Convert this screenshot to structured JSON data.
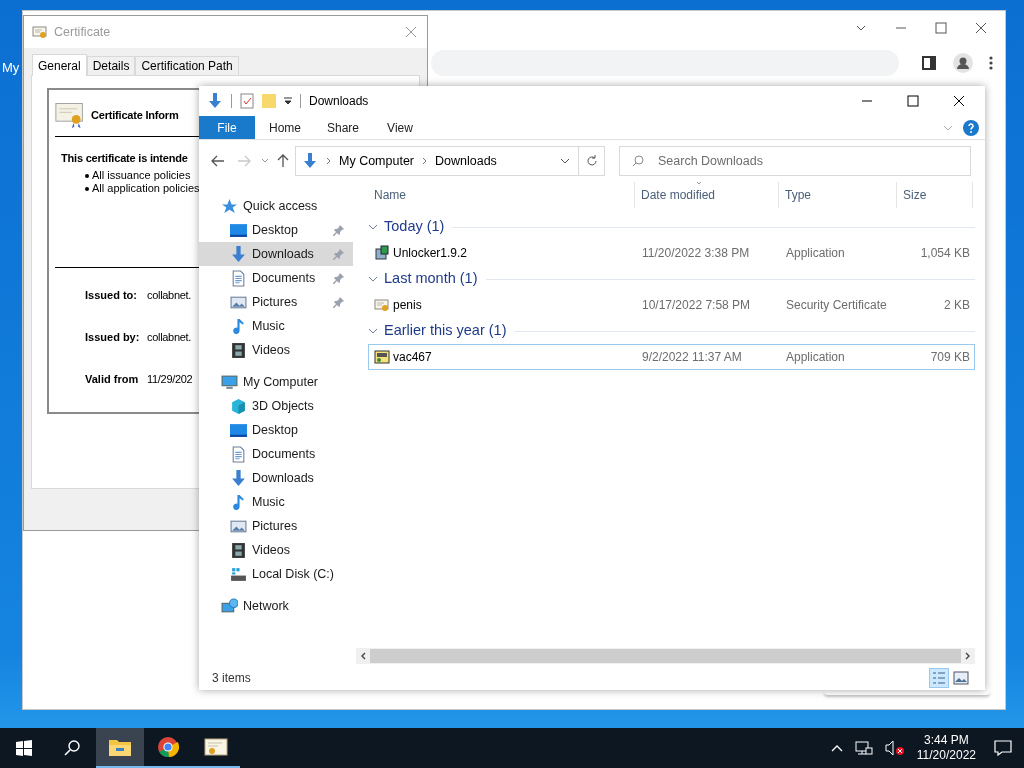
{
  "desktop": {
    "icon_label": "My"
  },
  "certificate": {
    "title": "Certificate",
    "tabs": [
      {
        "label": "General",
        "selected": true
      },
      {
        "label": "Details",
        "selected": false
      },
      {
        "label": "Certification Path",
        "selected": false
      }
    ],
    "heading": "Certificate Inform",
    "purpose": "This certificate is intende",
    "policies": [
      "All issuance policies",
      "All application policies"
    ],
    "fields": [
      {
        "label": "Issued to:",
        "value": "collabnet."
      },
      {
        "label": "Issued by:",
        "value": "collabnet."
      },
      {
        "label": "Valid from",
        "value": "11/29/202"
      }
    ]
  },
  "explorer": {
    "title": "Downloads",
    "ribbon_tabs": [
      {
        "label": "File",
        "selected": true
      },
      {
        "label": "Home",
        "selected": false
      },
      {
        "label": "Share",
        "selected": false
      },
      {
        "label": "View",
        "selected": false
      }
    ],
    "breadcrumb": [
      "My Computer",
      "Downloads"
    ],
    "search": {
      "placeholder": "Search Downloads"
    },
    "columns": [
      "Name",
      "Date modified",
      "Type",
      "Size"
    ],
    "groups": [
      {
        "label": "Today (1)",
        "expanded": true,
        "files": [
          {
            "name": "Unlocker1.9.2",
            "kind": "installer",
            "date": "11/20/2022 3:38 PM",
            "type": "Application",
            "size": "1,054 KB",
            "focused": false
          }
        ]
      },
      {
        "label": "Last month (1)",
        "expanded": true,
        "files": [
          {
            "name": "penis",
            "kind": "certificate",
            "date": "10/17/2022 7:58 PM",
            "type": "Security Certificate",
            "size": "2 KB",
            "focused": false
          }
        ]
      },
      {
        "label": "Earlier this year (1)",
        "expanded": true,
        "files": [
          {
            "name": "vac467",
            "kind": "application",
            "date": "9/2/2022 11:37 AM",
            "type": "Application",
            "size": "709 KB",
            "focused": true
          }
        ]
      }
    ],
    "nav": [
      {
        "label": "Quick access",
        "kind": "star",
        "pinned": false,
        "selected": false,
        "children": [
          {
            "label": "Desktop",
            "kind": "desktop",
            "pinned": true,
            "selected": false
          },
          {
            "label": "Downloads",
            "kind": "downloads",
            "pinned": true,
            "selected": true
          },
          {
            "label": "Documents",
            "kind": "documents",
            "pinned": true,
            "selected": false
          },
          {
            "label": "Pictures",
            "kind": "pictures",
            "pinned": true,
            "selected": false
          },
          {
            "label": "Music",
            "kind": "music",
            "pinned": false,
            "selected": false
          },
          {
            "label": "Videos",
            "kind": "videos",
            "pinned": false,
            "selected": false
          }
        ]
      },
      {
        "label": "My Computer",
        "kind": "computer",
        "pinned": false,
        "selected": false,
        "children": [
          {
            "label": "3D Objects",
            "kind": "objects3d",
            "pinned": false,
            "selected": false
          },
          {
            "label": "Desktop",
            "kind": "desktop",
            "pinned": false,
            "selected": false
          },
          {
            "label": "Documents",
            "kind": "documents",
            "pinned": false,
            "selected": false
          },
          {
            "label": "Downloads",
            "kind": "downloads",
            "pinned": false,
            "selected": false
          },
          {
            "label": "Music",
            "kind": "music",
            "pinned": false,
            "selected": false
          },
          {
            "label": "Pictures",
            "kind": "pictures",
            "pinned": false,
            "selected": false
          },
          {
            "label": "Videos",
            "kind": "videos",
            "pinned": false,
            "selected": false
          },
          {
            "label": "Local Disk (C:)",
            "kind": "disk",
            "pinned": false,
            "selected": false
          }
        ]
      },
      {
        "label": "Network",
        "kind": "network",
        "pinned": false,
        "selected": false
      }
    ],
    "status": "3 items"
  },
  "taskbar": {
    "apps": [
      {
        "kind": "explorer",
        "selected": true
      },
      {
        "kind": "chrome",
        "selected": false
      },
      {
        "kind": "certificate",
        "selected": false
      }
    ],
    "time": "3:44 PM",
    "date": "11/20/2022"
  }
}
